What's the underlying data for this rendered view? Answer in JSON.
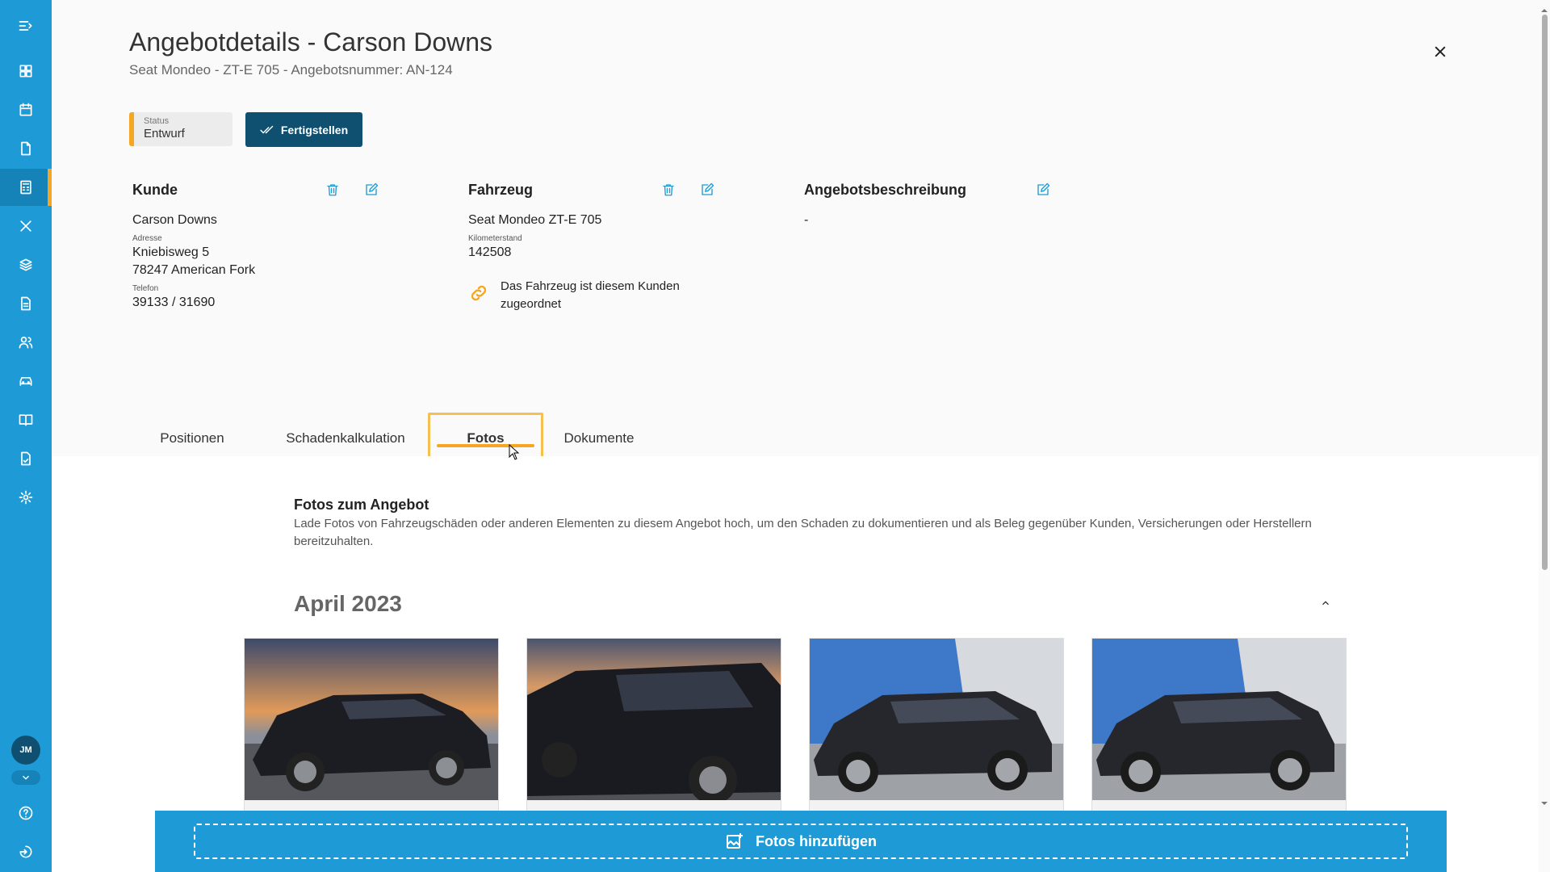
{
  "header": {
    "title": "Angebotdetails - Carson Downs",
    "subtitle": "Seat Mondeo - ZT-E 705 - Angebotsnummer: AN-124"
  },
  "status": {
    "label": "Status",
    "value": "Entwurf"
  },
  "actions": {
    "finish_label": "Fertigstellen"
  },
  "customer": {
    "title": "Kunde",
    "name": "Carson Downs",
    "address_label": "Adresse",
    "street": "Kniebisweg 5",
    "city": "78247 American Fork",
    "phone_label": "Telefon",
    "phone": "39133 / 31690"
  },
  "vehicle": {
    "title": "Fahrzeug",
    "name": "Seat Mondeo ZT-E 705",
    "mileage_label": "Kilometerstand",
    "mileage": "142508",
    "link_note": "Das Fahrzeug ist diesem Kunden zugeordnet"
  },
  "description": {
    "title": "Angebotsbeschreibung",
    "value": "-"
  },
  "tabs": [
    {
      "label": "Positionen"
    },
    {
      "label": "Schadenkalkulation"
    },
    {
      "label": "Fotos"
    },
    {
      "label": "Dokumente"
    }
  ],
  "active_tab": "Fotos",
  "photos_section": {
    "title": "Fotos zum Angebot",
    "description": "Lade Fotos von Fahrzeugschäden oder anderen Elementen zu diesem Angebot hoch, um den Schaden zu dokumentieren und als Beleg gegenüber Kunden, Versicherungen oder Herstellern bereitzuhalten.",
    "month": "April 2023"
  },
  "add_photos_label": "Fotos hinzufügen",
  "user": {
    "initials": "JM"
  },
  "colors": {
    "sidebar": "#1e9bd7",
    "primary_dark": "#0f4f6f",
    "accent": "#f5a623",
    "icon_blue": "#1e9bd7"
  }
}
